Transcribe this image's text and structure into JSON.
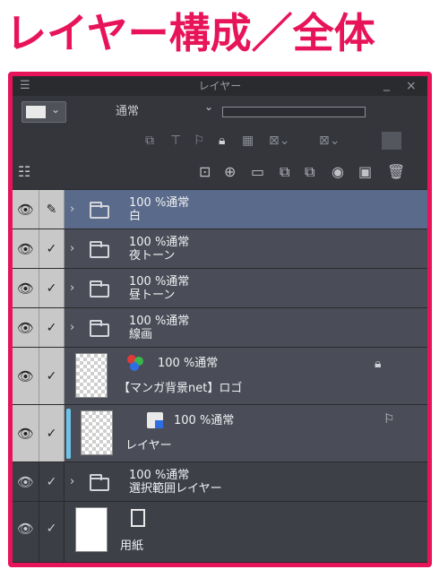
{
  "heading": "レイヤー構成／全体",
  "panel": {
    "title": "レイヤー",
    "blend_mode": "通常",
    "window_controls": {
      "minimize": "_",
      "close": "×"
    }
  },
  "toolbar_icons": [
    "clip-icon",
    "ruler-icon",
    "reference-icon",
    "lock-icon",
    "transparency-lock-icon",
    "mask-icon",
    "clear-mask-icon",
    "fill-icon"
  ],
  "toolbar2_icons": [
    "panel-menu-icon",
    "new-raster-layer-icon",
    "new-vector-layer-icon",
    "new-folder-icon",
    "copy-layer-icon",
    "merge-down-icon",
    "mask-icon",
    "add-mask-icon",
    "trash-icon"
  ],
  "layers": [
    {
      "line1": "100 %通常",
      "name": "白",
      "type": "folder",
      "selected": true
    },
    {
      "line1": "100 %通常",
      "name": "夜トーン",
      "type": "folder"
    },
    {
      "line1": "100 %通常",
      "name": "昼トーン",
      "type": "folder"
    },
    {
      "line1": "100 %通常",
      "name": "線画",
      "type": "folder"
    },
    {
      "line1": "100 %通常",
      "name": "【マンガ背景net】ロゴ",
      "type": "image"
    },
    {
      "line1": "100 %通常",
      "name": "レイヤー",
      "type": "raster"
    },
    {
      "line1": "100 %通常",
      "name": "選択範囲レイヤー",
      "type": "folder"
    },
    {
      "line1": "",
      "name": "用紙",
      "type": "paper"
    }
  ]
}
